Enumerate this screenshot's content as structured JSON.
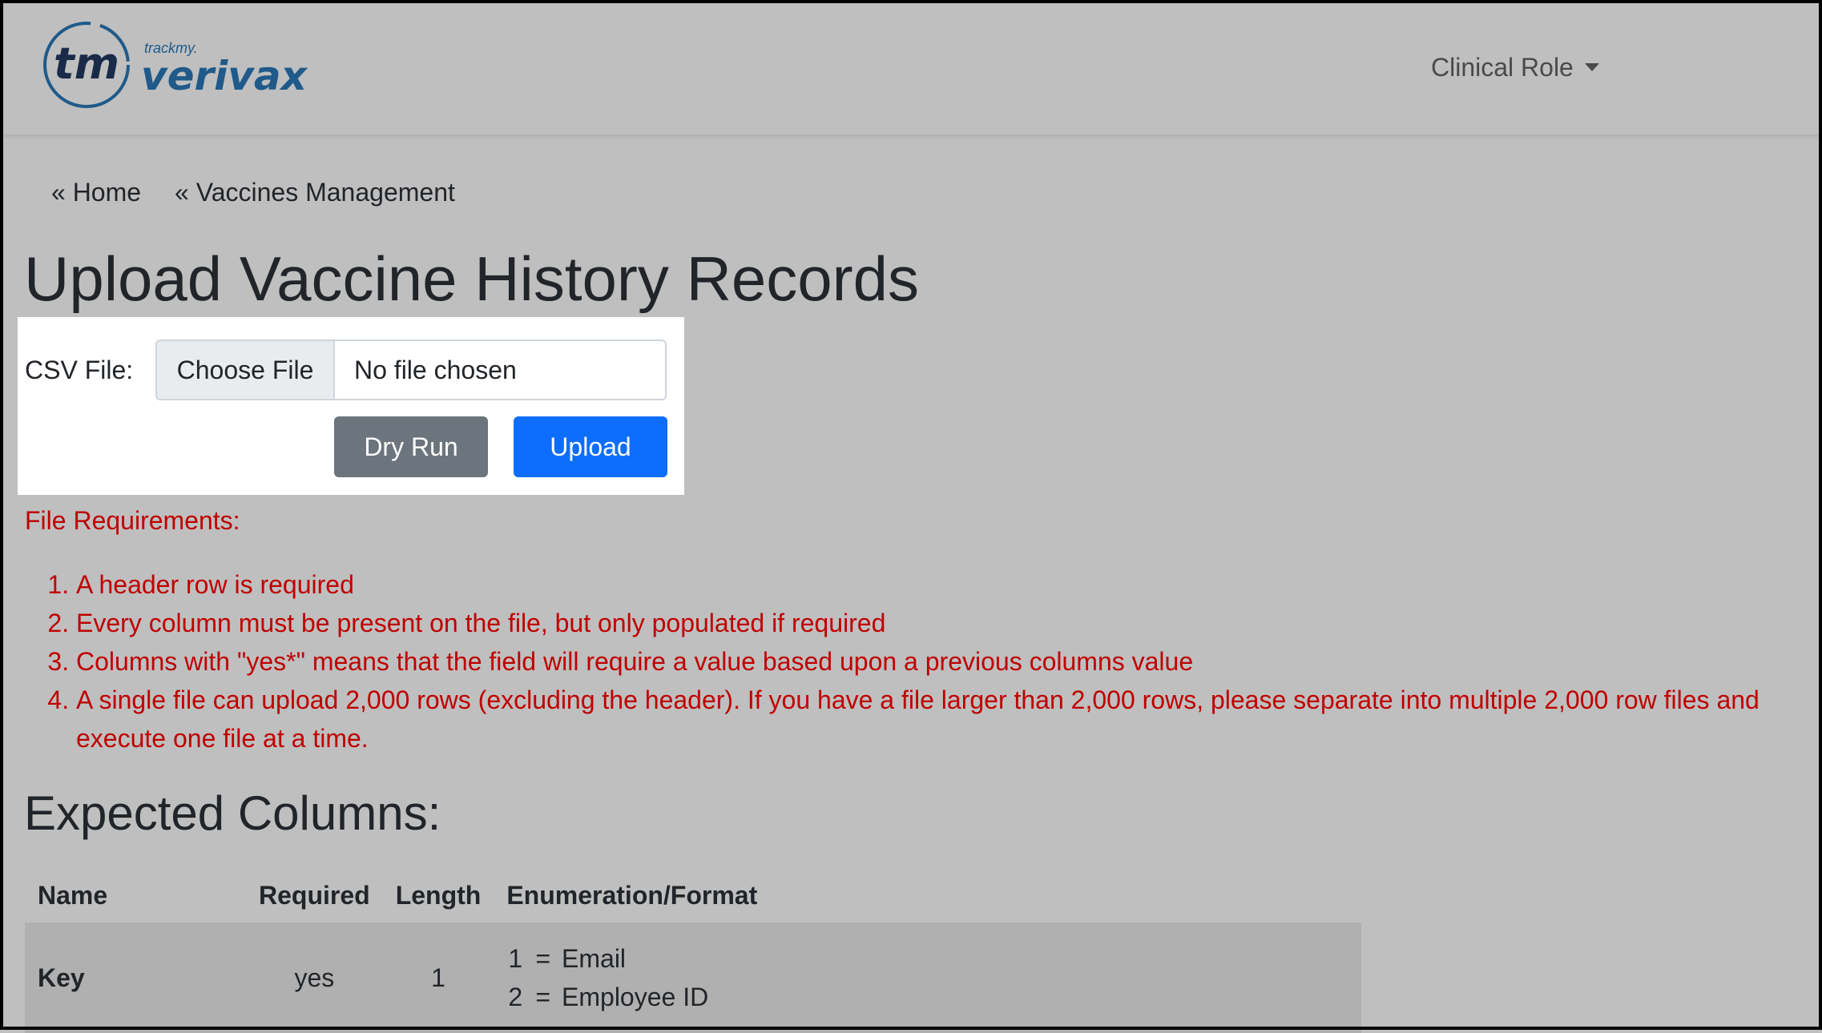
{
  "navbar": {
    "brand_small": "trackmy.",
    "brand_main": "verivax",
    "brand_mark": "tm",
    "role_menu": "Clinical Role",
    "brand_color": "#1f5a8a"
  },
  "breadcrumb": [
    {
      "label": "« Home"
    },
    {
      "label": "« Vaccines Management"
    }
  ],
  "page_title": "Upload Vaccine History Records",
  "upload": {
    "csv_label": "CSV File:",
    "choose_file": "Choose File",
    "file_status": "No file chosen",
    "dry_run": "Dry Run",
    "upload": "Upload"
  },
  "requirements": {
    "heading": "File Requirements:",
    "items": [
      "A header row is required",
      "Every column must be present on the file, but only populated if required",
      "Columns with \"yes*\" means that the field will require a value based upon a previous columns value",
      "A single file can upload 2,000 rows (excluding the header). If you have a file larger than 2,000 rows, please separate into multiple 2,000 row files and execute one file at a time."
    ]
  },
  "expected_columns": {
    "heading": "Expected Columns:",
    "headers": [
      "Name",
      "Required",
      "Length",
      "Enumeration/Format"
    ],
    "rows": [
      {
        "name": "Key",
        "required": "yes",
        "length": "1",
        "enum": [
          {
            "num": "1",
            "eq": "=",
            "label": "Email"
          },
          {
            "num": "2",
            "eq": "=",
            "label": "Employee ID"
          }
        ]
      }
    ]
  }
}
